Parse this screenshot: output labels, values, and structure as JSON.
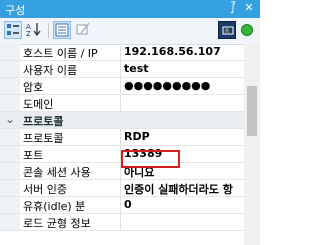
{
  "window": {
    "title": "구성",
    "pin_glyph": "⨛",
    "close_glyph": "✕"
  },
  "toolbar": {
    "categorized_icon": "categorized-view-icon",
    "sort_icon": "sort-az-icon",
    "sort_label": "A↓Z",
    "property_pages_icon": "property-pages-icon",
    "edit_icon": "edit-icon",
    "right_icon": "connection-settings-icon",
    "status_color": "#35b534"
  },
  "properties": [
    {
      "name": "호스트 이름 / IP",
      "value": "192.168.56.107"
    },
    {
      "name": "사용자 이름",
      "value": "test"
    },
    {
      "name": "암호",
      "value": "●●●●●●●●●"
    },
    {
      "name": "도메인",
      "value": ""
    },
    {
      "category": "프로토콜"
    },
    {
      "name": "프로토콜",
      "value": "RDP"
    },
    {
      "name": "포트",
      "value": "13389"
    },
    {
      "name": "콘솔 세션 사용",
      "value": "아니요"
    },
    {
      "name": "서버 인증",
      "value": "인증이 실패하더라도 항"
    },
    {
      "name": "유휴(idle) 분",
      "value": "0"
    },
    {
      "name": "로드 균형 정보",
      "value": ""
    }
  ],
  "highlight_color": "#d02020"
}
